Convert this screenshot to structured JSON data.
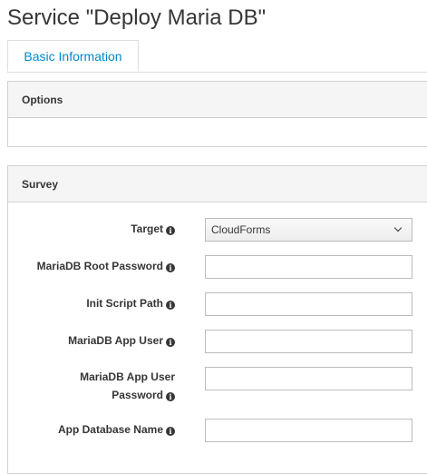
{
  "page": {
    "title": "Service \"Deploy Maria DB\""
  },
  "tabs": [
    {
      "label": "Basic Information"
    }
  ],
  "options_panel": {
    "heading": "Options"
  },
  "survey": {
    "heading": "Survey",
    "fields": [
      {
        "label": "Target",
        "type": "select",
        "value": "CloudForms"
      },
      {
        "label": "MariaDB Root Password",
        "type": "password",
        "value": ""
      },
      {
        "label": "Init Script Path",
        "type": "text",
        "value": ""
      },
      {
        "label": "MariaDB App User",
        "type": "text",
        "value": ""
      },
      {
        "label": "MariaDB App User Password",
        "type": "password",
        "value": ""
      },
      {
        "label": "App Database Name",
        "type": "text",
        "value": ""
      }
    ]
  },
  "icons": {
    "info": "info-circle-icon",
    "dropdown": "chevron-down-icon"
  },
  "colors": {
    "tab_text": "#0088ce",
    "panel_heading_bg": "#f5f5f5",
    "border": "#d1d1d1"
  }
}
